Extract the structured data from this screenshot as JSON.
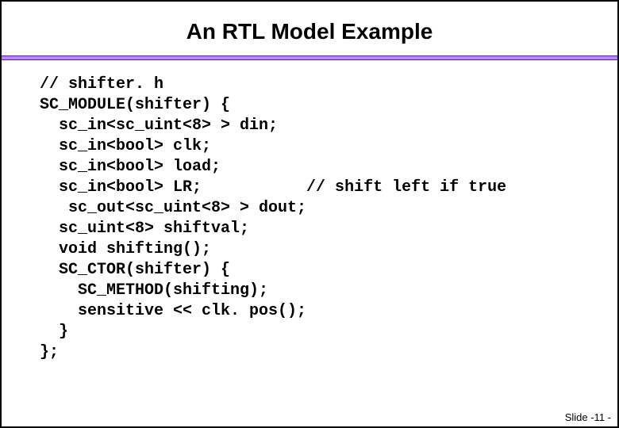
{
  "slide": {
    "title": "An RTL Model Example",
    "footer": "Slide -11 -"
  },
  "code": {
    "l0": "// shifter. h",
    "l1": "SC_MODULE(shifter) {",
    "l2": "  sc_in<sc_uint<8> > din;",
    "l3": "  sc_in<bool> clk;",
    "l4": "  sc_in<bool> load;",
    "l5": "  sc_in<bool> LR;           // shift left if true",
    "l6": "   sc_out<sc_uint<8> > dout;",
    "l7": "  sc_uint<8> shiftval;",
    "l8": "  void shifting();",
    "l9": "  SC_CTOR(shifter) {",
    "l10": "    SC_METHOD(shifting);",
    "l11": "    sensitive << clk. pos();",
    "l12": "  }",
    "l13": "};"
  }
}
